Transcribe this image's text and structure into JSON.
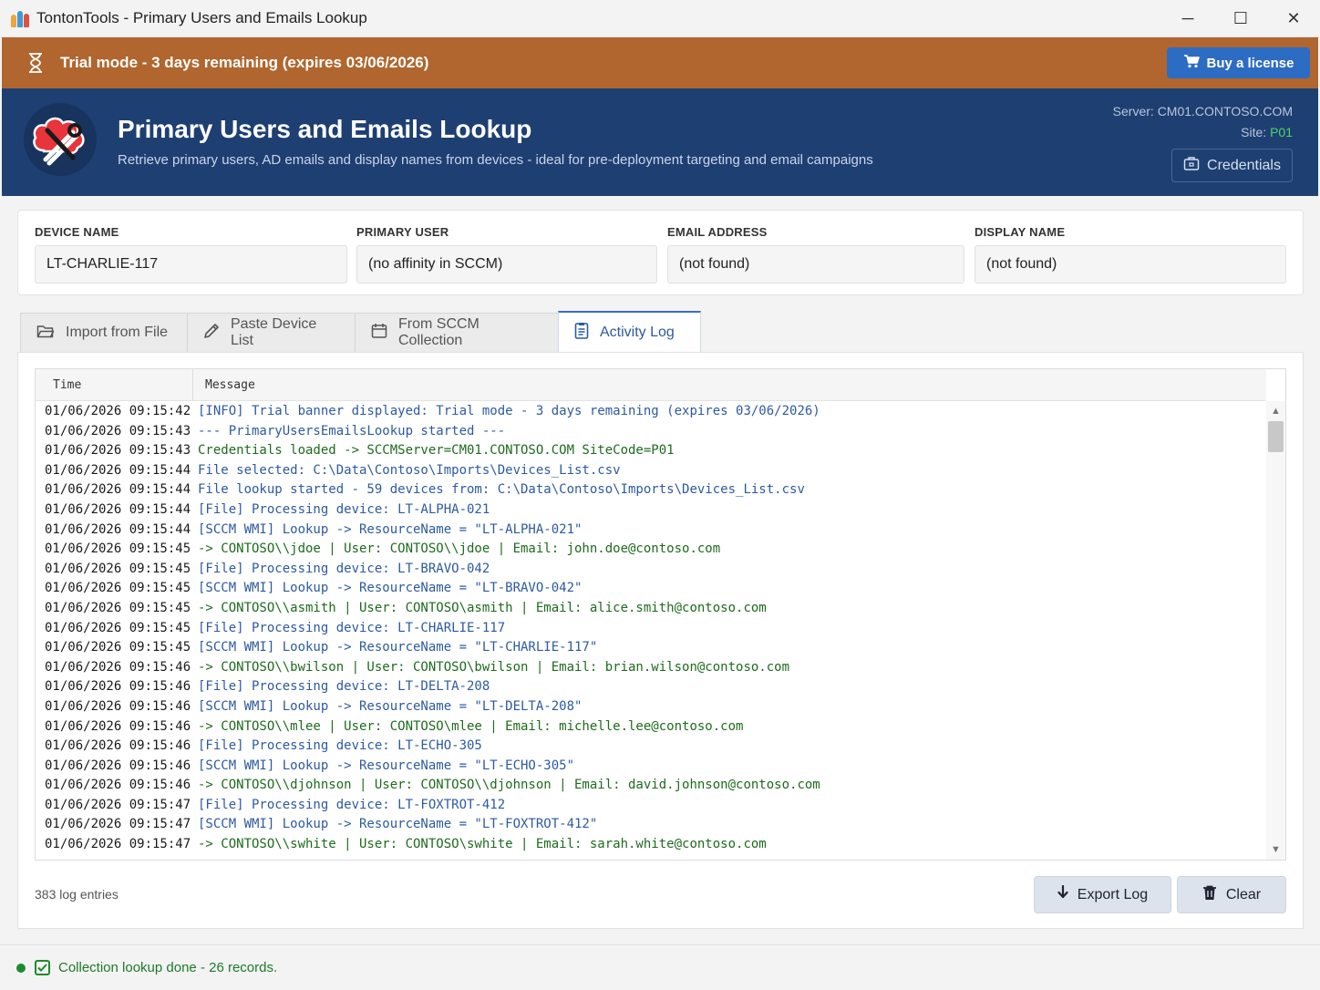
{
  "window": {
    "title": "TontonTools - Primary Users and Emails Lookup",
    "controls": {
      "minimize": "─",
      "maximize": "☐",
      "close": "✕"
    }
  },
  "trial_banner": {
    "text": "Trial mode - 3 days remaining (expires 03/06/2026)",
    "buy_label": "Buy a license",
    "color": "#b0662e"
  },
  "header": {
    "title": "Primary Users and Emails Lookup",
    "subtitle": "Retrieve primary users, AD emails and display names from devices - ideal for pre-deployment targeting and email campaigns",
    "server_label": "Server:",
    "server_value": "CM01.CONTOSO.COM",
    "site_label": "Site:",
    "site_value": "P01",
    "credentials_label": "Credentials",
    "color": "#1e3f72"
  },
  "fields": [
    {
      "label": "DEVICE NAME",
      "value": "LT-CHARLIE-117"
    },
    {
      "label": "PRIMARY USER",
      "value": "(no affinity in SCCM)"
    },
    {
      "label": "EMAIL ADDRESS",
      "value": "(not found)"
    },
    {
      "label": "DISPLAY NAME",
      "value": "(not found)"
    }
  ],
  "tabs": [
    {
      "label": "Import from File",
      "icon": "folder-icon",
      "active": false
    },
    {
      "label": "Paste Device List",
      "icon": "pencil-icon",
      "active": false
    },
    {
      "label": "From SCCM Collection",
      "icon": "calendar-icon",
      "active": false
    },
    {
      "label": "Activity Log",
      "icon": "clipboard-icon",
      "active": true
    }
  ],
  "log": {
    "columns": {
      "time": "Time",
      "message": "Message"
    },
    "rows": [
      {
        "time": "01/06/2026 09:15:42",
        "message": "[INFO] Trial banner displayed: Trial mode - 3 days remaining (expires 03/06/2026)",
        "level": "info"
      },
      {
        "time": "01/06/2026 09:15:43",
        "message": "--- PrimaryUsersEmailsLookup started ---",
        "level": "info"
      },
      {
        "time": "01/06/2026 09:15:43",
        "message": "Credentials loaded -> SCCMServer=CM01.CONTOSO.COM  SiteCode=P01",
        "level": "ok"
      },
      {
        "time": "01/06/2026 09:15:44",
        "message": "File selected: C:\\Data\\Contoso\\Imports\\Devices_List.csv",
        "level": "info"
      },
      {
        "time": "01/06/2026 09:15:44",
        "message": "File lookup started - 59 devices from: C:\\Data\\Contoso\\Imports\\Devices_List.csv",
        "level": "info"
      },
      {
        "time": "01/06/2026 09:15:44",
        "message": "[File] Processing device: LT-ALPHA-021",
        "level": "info"
      },
      {
        "time": "01/06/2026 09:15:44",
        "message": " [SCCM WMI] Lookup -> ResourceName = \"LT-ALPHA-021\"",
        "level": "info"
      },
      {
        "time": "01/06/2026 09:15:45",
        "message": "-> CONTOSO\\\\jdoe  |  User: CONTOSO\\\\jdoe  |  Email: john.doe@contoso.com",
        "level": "ok"
      },
      {
        "time": "01/06/2026 09:15:45",
        "message": "[File] Processing device: LT-BRAVO-042",
        "level": "info"
      },
      {
        "time": "01/06/2026 09:15:45",
        "message": " [SCCM WMI] Lookup -> ResourceName = \"LT-BRAVO-042\"",
        "level": "info"
      },
      {
        "time": "01/06/2026 09:15:45",
        "message": "-> CONTOSO\\\\asmith  |  User: CONTOSO\\asmith  |  Email: alice.smith@contoso.com",
        "level": "ok"
      },
      {
        "time": "01/06/2026 09:15:45",
        "message": "[File] Processing device: LT-CHARLIE-117",
        "level": "info"
      },
      {
        "time": "01/06/2026 09:15:45",
        "message": " [SCCM WMI] Lookup -> ResourceName = \"LT-CHARLIE-117\"",
        "level": "info"
      },
      {
        "time": "01/06/2026 09:15:46",
        "message": "-> CONTOSO\\\\bwilson  |  User: CONTOSO\\bwilson  |  Email: brian.wilson@contoso.com",
        "level": "ok"
      },
      {
        "time": "01/06/2026 09:15:46",
        "message": "[File] Processing device: LT-DELTA-208",
        "level": "info"
      },
      {
        "time": "01/06/2026 09:15:46",
        "message": " [SCCM WMI] Lookup -> ResourceName = \"LT-DELTA-208\"",
        "level": "info"
      },
      {
        "time": "01/06/2026 09:15:46",
        "message": "-> CONTOSO\\\\mlee  |  User: CONTOSO\\mlee  |  Email: michelle.lee@contoso.com",
        "level": "ok"
      },
      {
        "time": "01/06/2026 09:15:46",
        "message": "[File] Processing device: LT-ECHO-305",
        "level": "info"
      },
      {
        "time": "01/06/2026 09:15:46",
        "message": " [SCCM WMI] Lookup -> ResourceName = \"LT-ECHO-305\"",
        "level": "info"
      },
      {
        "time": "01/06/2026 09:15:46",
        "message": "-> CONTOSO\\\\djohnson  |  User: CONTOSO\\\\djohnson  |  Email: david.johnson@contoso.com",
        "level": "ok"
      },
      {
        "time": "01/06/2026 09:15:47",
        "message": "[File] Processing device: LT-FOXTROT-412",
        "level": "info"
      },
      {
        "time": "01/06/2026 09:15:47",
        "message": " [SCCM WMI] Lookup -> ResourceName = \"LT-FOXTROT-412\"",
        "level": "info"
      },
      {
        "time": "01/06/2026 09:15:47",
        "message": "-> CONTOSO\\\\swhite  |  User: CONTOSO\\swhite  |  Email: sarah.white@contoso.com",
        "level": "ok"
      }
    ],
    "count_text": "383 log entries",
    "export_label": "Export Log",
    "clear_label": "Clear"
  },
  "status": {
    "text": "Collection lookup done - 26 records.",
    "color": "#1e8a2e"
  }
}
